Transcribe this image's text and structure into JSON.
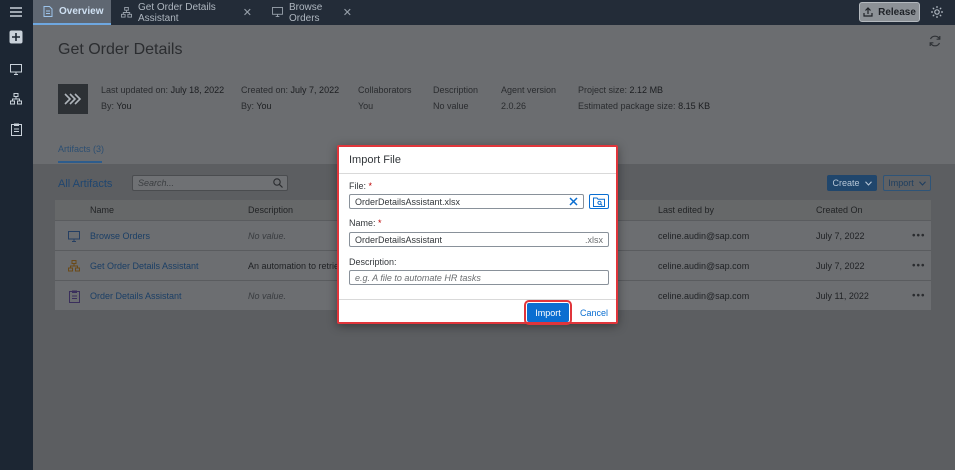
{
  "shell": {
    "tabs": [
      {
        "label": "Overview",
        "icon": "document-icon"
      },
      {
        "label": "Get Order Details Assistant",
        "icon": "hierarchy-icon"
      },
      {
        "label": "Browse Orders",
        "icon": "monitor-icon"
      }
    ],
    "release_label": "Release"
  },
  "page": {
    "title": "Get Order Details",
    "meta": {
      "last_updated_label": "Last updated on:",
      "last_updated_value": "July 18, 2022",
      "last_by_label": "By:",
      "last_by_value": "You",
      "created_label": "Created on:",
      "created_value": "July 7, 2022",
      "created_by_label": "By:",
      "created_by_value": "You",
      "collaborators_label": "Collaborators",
      "collaborators_value": "You",
      "description_label": "Description",
      "description_value": "No value",
      "agent_label": "Agent version",
      "agent_value": "2.0.26",
      "project_size_label": "Project size:",
      "project_size_value": "2.12 MB",
      "package_size_label": "Estimated package size:",
      "package_size_value": "8.15 KB"
    },
    "artifacts_tab": "Artifacts (3)",
    "all_artifacts": "All Artifacts",
    "search_placeholder": "Search...",
    "create_label": "Create",
    "import_label": "Import",
    "columns": [
      "Name",
      "Description",
      "Last edited by",
      "Created On"
    ],
    "rows": [
      {
        "name": "Browse Orders",
        "description": "No value.",
        "edited_by": "celine.audin@sap.com",
        "created": "July 7, 2022",
        "icon": "monitor-icon"
      },
      {
        "name": "Get Order Details Assistant",
        "description": "An automation to retrie",
        "edited_by": "celine.audin@sap.com",
        "created": "July 7, 2022",
        "icon": "hierarchy-icon"
      },
      {
        "name": "Order Details Assistant",
        "description": "No value.",
        "edited_by": "celine.audin@sap.com",
        "created": "July 11, 2022",
        "icon": "clipboard-icon"
      }
    ],
    "row_menu": "•••"
  },
  "dialog": {
    "title": "Import File",
    "file_label": "File:",
    "file_value": "OrderDetailsAssistant.xlsx",
    "name_label": "Name:",
    "name_value": "OrderDetailsAssistant",
    "name_suffix": ".xlsx",
    "description_label": "Description:",
    "description_placeholder": "e.g. A file to automate HR tasks",
    "required_mark": "*",
    "import_button": "Import",
    "cancel_button": "Cancel"
  },
  "colors": {
    "accent": "#0a6ed1",
    "highlight": "#e0353b"
  }
}
